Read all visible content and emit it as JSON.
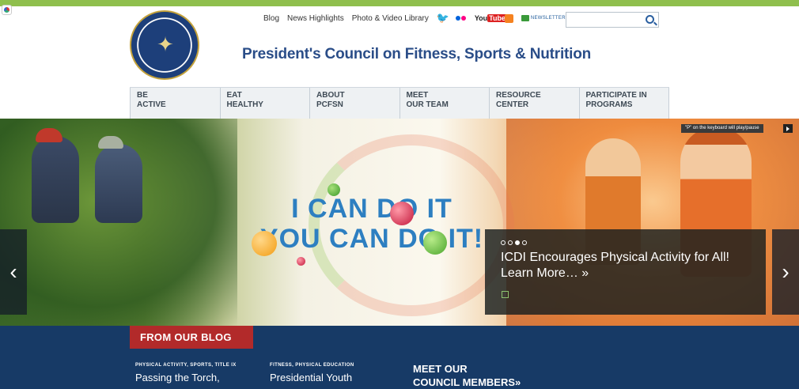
{
  "site": {
    "title": "President's Council on Fitness, Sports & Nutrition",
    "seal_text": "President's Council on Fitness, Sports & Nutrition"
  },
  "utility": {
    "blog": "Blog",
    "news": "News Highlights",
    "photo_video": "Photo & Video Library",
    "youtube": "You",
    "youtube_badge": "Tube",
    "newsletter": "NEWSLETTER"
  },
  "search": {
    "placeholder": ""
  },
  "nav": {
    "items": [
      {
        "label": "BE\nACTIVE"
      },
      {
        "label": "EAT\nHEALTHY"
      },
      {
        "label": "ABOUT\nPCFSN"
      },
      {
        "label": "MEET\nOUR TEAM"
      },
      {
        "label": "RESOURCE\nCENTER"
      },
      {
        "label": "PARTICIPATE IN\nPROGRAMS"
      }
    ]
  },
  "hero": {
    "hint": "\"P\" on the keyboard will play/pause",
    "headline_1": "I CAN DO IT",
    "headline_2": "YOU CAN DO IT!",
    "caption": "ICDI Encourages Physical Activity for All! Learn More… »",
    "prev": "‹",
    "next": "›"
  },
  "blog": {
    "tab": "FROM OUR BLOG",
    "posts": [
      {
        "category": "PHYSICAL ACTIVITY, SPORTS, TITLE IX",
        "title": "Passing the Torch,"
      },
      {
        "category": "FITNESS, PHYSICAL EDUCATION",
        "title": "Presidential Youth"
      }
    ],
    "members": "MEET OUR\nCOUNCIL MEMBERS»"
  },
  "colors": {
    "accent_green": "#8fbf4d",
    "brand_blue": "#2a4d88",
    "blog_band": "#173a66",
    "blog_tab": "#b22a2a"
  }
}
